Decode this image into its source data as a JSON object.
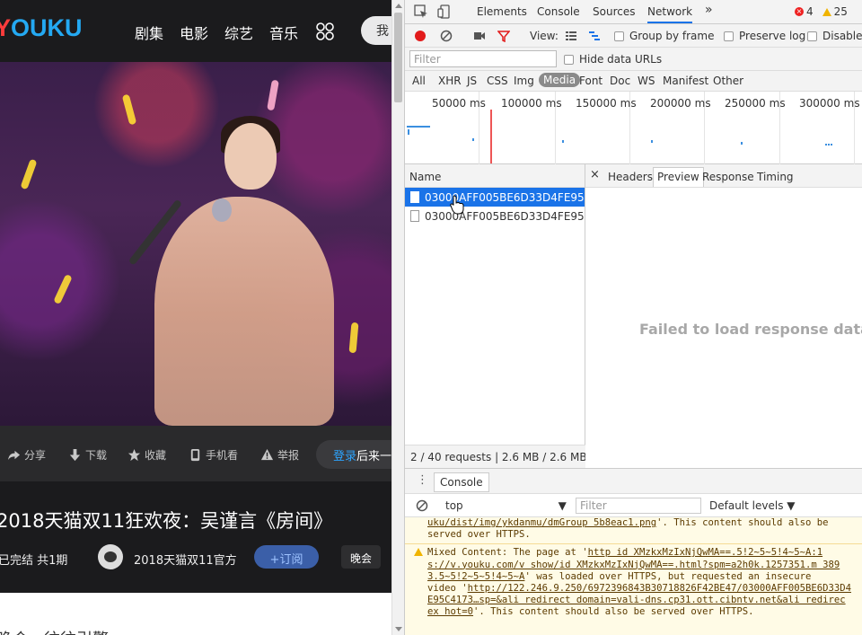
{
  "site": {
    "logo": {
      "part1": "Y",
      "part2": "OUKU"
    },
    "nav": [
      "剧集",
      "电影",
      "综艺",
      "音乐"
    ],
    "search_label": "我",
    "actions": [
      "分享",
      "下载",
      "收藏",
      "手机看",
      "举报"
    ],
    "login": {
      "link": "登录",
      "text": "后来一"
    },
    "title": "2018天猫双11狂欢夜：吴谨言《房间》",
    "episode_info": "已完结 共1期",
    "channel_name": "2018天猫双11官方",
    "subscribe_label": "+订阅",
    "tag_label": "晚会",
    "below_text": "晚会 · 往往引擎"
  },
  "devtools": {
    "tabs": [
      "Elements",
      "Console",
      "Sources",
      "Network"
    ],
    "active_tab": "Network",
    "more_tabs": "»",
    "error_count": "4",
    "warning_count": "25",
    "toolbar": {
      "view_label": "View:",
      "group_by_frame": "Group by frame",
      "preserve_log": "Preserve log",
      "disable_cache": "Disable"
    },
    "filter_placeholder": "Filter",
    "hide_data_urls": "Hide data URLs",
    "types": [
      "All",
      "XHR",
      "JS",
      "CSS",
      "Img",
      "Media",
      "Font",
      "Doc",
      "WS",
      "Manifest",
      "Other"
    ],
    "active_type": "Media",
    "timeline_ticks": [
      "50000 ms",
      "100000 ms",
      "150000 ms",
      "200000 ms",
      "250000 ms",
      "300000 ms"
    ],
    "name_header": "Name",
    "requests": [
      {
        "name": "03000AFF005BE6D33D4FE95C...",
        "selected": true
      },
      {
        "name": "03000AFF005BE6D33D4FE95C...",
        "selected": false
      }
    ],
    "request_status": "2 / 40 requests | 2.6 MB / 2.6 MB ...",
    "detail_tabs": [
      "Headers",
      "Preview",
      "Response",
      "Timing"
    ],
    "active_detail_tab": "Preview",
    "close_symbol": "×",
    "failed_message": "Failed to load response data",
    "drawer_tab": "Console",
    "console": {
      "context": "top",
      "filter_placeholder": "Filter",
      "levels": "Default levels ▼",
      "log_lines": [
        {
          "parts": [
            {
              "t": "uku/dist/img/ykdanmu/dmGroup 5b8eac1.png",
              "u": true
            },
            {
              "t": "'. This content should also be",
              "u": false
            }
          ]
        },
        {
          "parts": [
            {
              "t": "served over HTTPS.",
              "u": false
            }
          ]
        },
        {
          "parts": [
            {
              "t": "Mixed Content: The page at '",
              "u": false
            },
            {
              "t": "http id XMzkxMzIxNjQwMA==.5!2~5~5!4~5~A:1",
              "u": true
            }
          ],
          "sep": true
        },
        {
          "parts": [
            {
              "t": "s://v.youku.com/v show/id XMzkxMzIxNjQwMA==.html?spm=a2h0k.1257351.m 389",
              "u": true
            }
          ]
        },
        {
          "parts": [
            {
              "t": "3.5~5!2~5~5!4~5~A",
              "u": true
            },
            {
              "t": "' was loaded over HTTPS, but requested an insecure",
              "u": false
            }
          ]
        },
        {
          "parts": [
            {
              "t": "video '",
              "u": false
            },
            {
              "t": "http://122.246.9.250/6972396843B30718826F42BE47/03000AFF005BE6D33D4",
              "u": true
            }
          ]
        },
        {
          "parts": [
            {
              "t": "E95C4173…sp=&ali redirect domain=vali-dns.cp31.ott.cibntv.net&ali redirec",
              "u": true
            }
          ]
        },
        {
          "parts": [
            {
              "t": "ex hot=0",
              "u": true
            },
            {
              "t": "'. This content should also be served over HTTPS.",
              "u": false
            }
          ]
        }
      ]
    }
  }
}
